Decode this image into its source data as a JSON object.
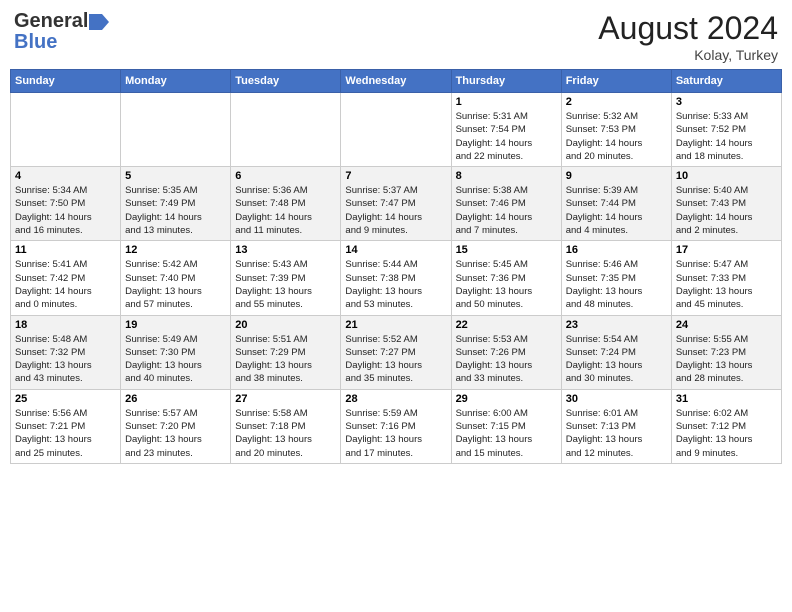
{
  "header": {
    "logo_general": "General",
    "logo_blue": "Blue",
    "month_year": "August 2024",
    "location": "Kolay, Turkey"
  },
  "days_of_week": [
    "Sunday",
    "Monday",
    "Tuesday",
    "Wednesday",
    "Thursday",
    "Friday",
    "Saturday"
  ],
  "weeks": [
    [
      {
        "day": "",
        "info": ""
      },
      {
        "day": "",
        "info": ""
      },
      {
        "day": "",
        "info": ""
      },
      {
        "day": "",
        "info": ""
      },
      {
        "day": "1",
        "info": "Sunrise: 5:31 AM\nSunset: 7:54 PM\nDaylight: 14 hours\nand 22 minutes."
      },
      {
        "day": "2",
        "info": "Sunrise: 5:32 AM\nSunset: 7:53 PM\nDaylight: 14 hours\nand 20 minutes."
      },
      {
        "day": "3",
        "info": "Sunrise: 5:33 AM\nSunset: 7:52 PM\nDaylight: 14 hours\nand 18 minutes."
      }
    ],
    [
      {
        "day": "4",
        "info": "Sunrise: 5:34 AM\nSunset: 7:50 PM\nDaylight: 14 hours\nand 16 minutes."
      },
      {
        "day": "5",
        "info": "Sunrise: 5:35 AM\nSunset: 7:49 PM\nDaylight: 14 hours\nand 13 minutes."
      },
      {
        "day": "6",
        "info": "Sunrise: 5:36 AM\nSunset: 7:48 PM\nDaylight: 14 hours\nand 11 minutes."
      },
      {
        "day": "7",
        "info": "Sunrise: 5:37 AM\nSunset: 7:47 PM\nDaylight: 14 hours\nand 9 minutes."
      },
      {
        "day": "8",
        "info": "Sunrise: 5:38 AM\nSunset: 7:46 PM\nDaylight: 14 hours\nand 7 minutes."
      },
      {
        "day": "9",
        "info": "Sunrise: 5:39 AM\nSunset: 7:44 PM\nDaylight: 14 hours\nand 4 minutes."
      },
      {
        "day": "10",
        "info": "Sunrise: 5:40 AM\nSunset: 7:43 PM\nDaylight: 14 hours\nand 2 minutes."
      }
    ],
    [
      {
        "day": "11",
        "info": "Sunrise: 5:41 AM\nSunset: 7:42 PM\nDaylight: 14 hours\nand 0 minutes."
      },
      {
        "day": "12",
        "info": "Sunrise: 5:42 AM\nSunset: 7:40 PM\nDaylight: 13 hours\nand 57 minutes."
      },
      {
        "day": "13",
        "info": "Sunrise: 5:43 AM\nSunset: 7:39 PM\nDaylight: 13 hours\nand 55 minutes."
      },
      {
        "day": "14",
        "info": "Sunrise: 5:44 AM\nSunset: 7:38 PM\nDaylight: 13 hours\nand 53 minutes."
      },
      {
        "day": "15",
        "info": "Sunrise: 5:45 AM\nSunset: 7:36 PM\nDaylight: 13 hours\nand 50 minutes."
      },
      {
        "day": "16",
        "info": "Sunrise: 5:46 AM\nSunset: 7:35 PM\nDaylight: 13 hours\nand 48 minutes."
      },
      {
        "day": "17",
        "info": "Sunrise: 5:47 AM\nSunset: 7:33 PM\nDaylight: 13 hours\nand 45 minutes."
      }
    ],
    [
      {
        "day": "18",
        "info": "Sunrise: 5:48 AM\nSunset: 7:32 PM\nDaylight: 13 hours\nand 43 minutes."
      },
      {
        "day": "19",
        "info": "Sunrise: 5:49 AM\nSunset: 7:30 PM\nDaylight: 13 hours\nand 40 minutes."
      },
      {
        "day": "20",
        "info": "Sunrise: 5:51 AM\nSunset: 7:29 PM\nDaylight: 13 hours\nand 38 minutes."
      },
      {
        "day": "21",
        "info": "Sunrise: 5:52 AM\nSunset: 7:27 PM\nDaylight: 13 hours\nand 35 minutes."
      },
      {
        "day": "22",
        "info": "Sunrise: 5:53 AM\nSunset: 7:26 PM\nDaylight: 13 hours\nand 33 minutes."
      },
      {
        "day": "23",
        "info": "Sunrise: 5:54 AM\nSunset: 7:24 PM\nDaylight: 13 hours\nand 30 minutes."
      },
      {
        "day": "24",
        "info": "Sunrise: 5:55 AM\nSunset: 7:23 PM\nDaylight: 13 hours\nand 28 minutes."
      }
    ],
    [
      {
        "day": "25",
        "info": "Sunrise: 5:56 AM\nSunset: 7:21 PM\nDaylight: 13 hours\nand 25 minutes."
      },
      {
        "day": "26",
        "info": "Sunrise: 5:57 AM\nSunset: 7:20 PM\nDaylight: 13 hours\nand 23 minutes."
      },
      {
        "day": "27",
        "info": "Sunrise: 5:58 AM\nSunset: 7:18 PM\nDaylight: 13 hours\nand 20 minutes."
      },
      {
        "day": "28",
        "info": "Sunrise: 5:59 AM\nSunset: 7:16 PM\nDaylight: 13 hours\nand 17 minutes."
      },
      {
        "day": "29",
        "info": "Sunrise: 6:00 AM\nSunset: 7:15 PM\nDaylight: 13 hours\nand 15 minutes."
      },
      {
        "day": "30",
        "info": "Sunrise: 6:01 AM\nSunset: 7:13 PM\nDaylight: 13 hours\nand 12 minutes."
      },
      {
        "day": "31",
        "info": "Sunrise: 6:02 AM\nSunset: 7:12 PM\nDaylight: 13 hours\nand 9 minutes."
      }
    ]
  ]
}
